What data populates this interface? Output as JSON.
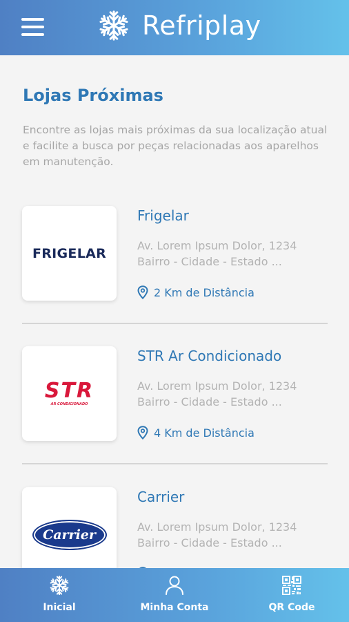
{
  "header": {
    "app_name": "Refriplay",
    "menu_icon": "hamburger-menu-icon",
    "logo_icon": "snowflake-icon"
  },
  "main": {
    "title": "Lojas Próximas",
    "description": "Encontre as lojas mais próximas da sua localização atual e facilite a busca por peças relacionadas aos aparelhos em manutenção."
  },
  "stores": [
    {
      "name": "Frigelar",
      "logo_text": "FRIGELAR",
      "address_line1": "Av. Lorem Ipsum Dolor, 1234",
      "address_line2": "Bairro - Cidade - Estado ...",
      "distance": "2 Km de Distância"
    },
    {
      "name": "STR Ar Condicionado",
      "logo_text": "STR",
      "logo_subtext": "AR CONDICIONADO",
      "address_line1": "Av. Lorem Ipsum Dolor, 1234",
      "address_line2": "Bairro - Cidade - Estado ...",
      "distance": "4 Km de Distância"
    },
    {
      "name": "Carrier",
      "logo_text": "Carrier",
      "address_line1": "Av. Lorem Ipsum Dolor, 1234",
      "address_line2": "Bairro - Cidade - Estado ..."
    }
  ],
  "bottom_nav": {
    "items": [
      {
        "label": "Inicial",
        "icon": "snowflake-icon"
      },
      {
        "label": "Minha Conta",
        "icon": "user-icon"
      },
      {
        "label": "QR Code",
        "icon": "qr-code-icon"
      }
    ]
  },
  "colors": {
    "accent": "#2f78b5",
    "header_gradient_start": "#4f80c4",
    "header_gradient_end": "#64c1ea",
    "muted_text": "#a6a6a6",
    "frigelar_navy": "#1a2a5a",
    "str_red": "#d9183b",
    "carrier_blue": "#1a3a8c"
  }
}
